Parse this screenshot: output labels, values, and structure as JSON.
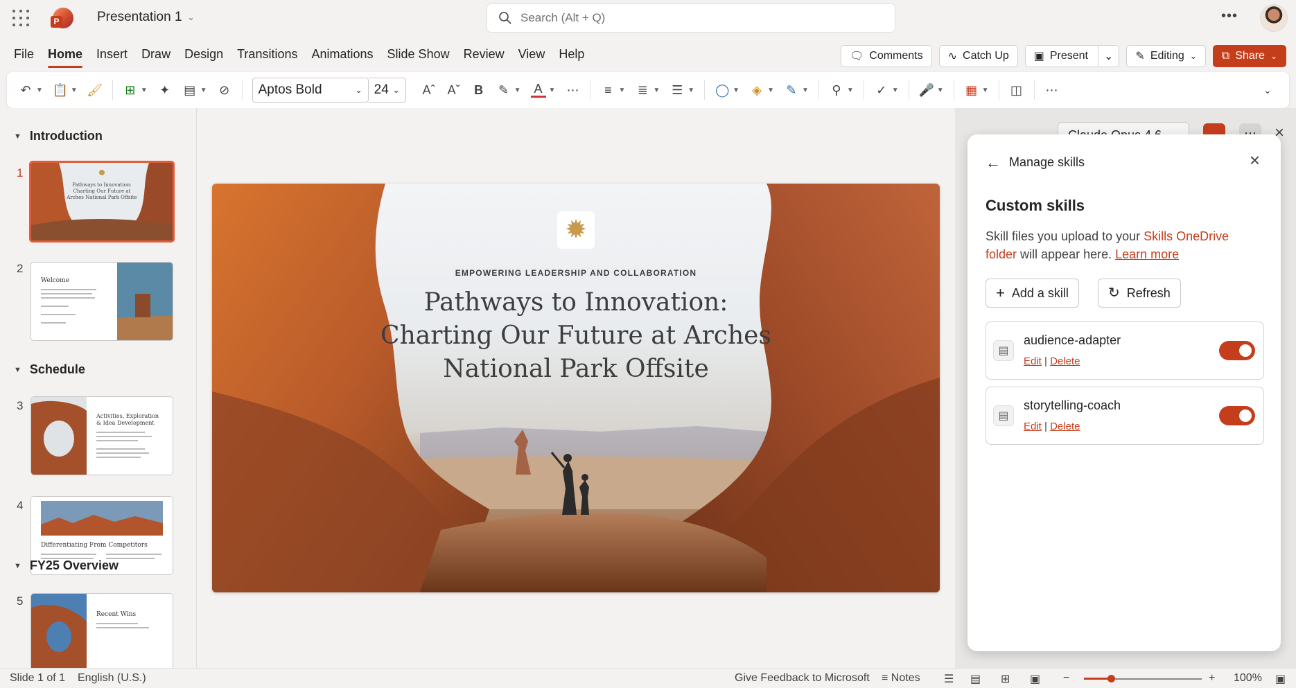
{
  "titlebar": {
    "doc_title": "Presentation 1",
    "search_placeholder": "Search (Alt + Q)",
    "more": "•••"
  },
  "menu": {
    "tabs": [
      "File",
      "Home",
      "Insert",
      "Draw",
      "Design",
      "Transitions",
      "Animations",
      "Slide Show",
      "Review",
      "View",
      "Help"
    ],
    "active_tab": "Home",
    "actions": {
      "comments": "Comments",
      "catch_up": "Catch Up",
      "present": "Present",
      "editing": "Editing",
      "share": "Share"
    }
  },
  "ribbon": {
    "font_name": "Aptos Bold",
    "font_size": "24"
  },
  "thumbnails": {
    "sections": [
      "Introduction",
      "Schedule",
      "FY25 Overview"
    ],
    "slides": [
      {
        "num": "1",
        "title": "Pathways to Innovation: Charting Our Future at Arches National Park Offsite"
      },
      {
        "num": "2",
        "title": "Welcome"
      },
      {
        "num": "3",
        "title": "Activities, Exploration & Idea Development"
      },
      {
        "num": "4",
        "title": "Differentiating From Competitors"
      },
      {
        "num": "5",
        "title": "Recent Wins"
      }
    ]
  },
  "slide": {
    "kicker": "EMPOWERING LEADERSHIP AND COLLABORATION",
    "title": "Pathways to Innovation: Charting Our Future at Arches National Park Offsite"
  },
  "sidepane": {
    "model": "Claude Opus 4.6",
    "card": {
      "title": "Manage skills",
      "heading": "Custom skills",
      "desc_prefix": "Skill files you upload to your ",
      "desc_link1": "Skills OneDrive folder",
      "desc_mid": " will appear here. ",
      "desc_link2": "Learn more",
      "add_button": "Add a skill",
      "refresh_button": "Refresh",
      "edit": "Edit",
      "delete": "Delete",
      "skills": [
        {
          "name": "audience-adapter",
          "enabled": true
        },
        {
          "name": "storytelling-coach",
          "enabled": true
        }
      ]
    }
  },
  "status": {
    "slide_info": "Slide 1 of 1",
    "language": "English (U.S.)",
    "feedback": "Give Feedback to Microsoft",
    "notes": "Notes",
    "zoom": "100%"
  },
  "colors": {
    "accent": "#c43e1c"
  }
}
